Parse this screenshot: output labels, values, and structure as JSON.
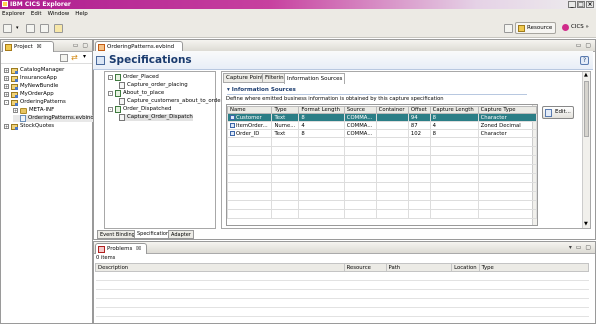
{
  "window": {
    "title": "IBM CICS Explorer"
  },
  "menu": [
    "Explorer",
    "Edit",
    "Window",
    "Help"
  ],
  "perspectives": {
    "resource": "Resource",
    "cics": "CICS",
    "more": "»"
  },
  "project_view": {
    "title": "Project",
    "tree": [
      {
        "label": "CatalogManager",
        "level": 0,
        "kind": "project",
        "expander": "+"
      },
      {
        "label": "InsuranceApp",
        "level": 0,
        "kind": "project",
        "expander": "+"
      },
      {
        "label": "MyNewBundle",
        "level": 0,
        "kind": "project",
        "expander": "+"
      },
      {
        "label": "MyOrderApp",
        "level": 0,
        "kind": "project",
        "expander": "+"
      },
      {
        "label": "OrderingPatterns",
        "level": 0,
        "kind": "project",
        "expander": "-"
      },
      {
        "label": "META-INF",
        "level": 1,
        "kind": "folder",
        "expander": "+"
      },
      {
        "label": "OrderingPatterns.evbind",
        "level": 1,
        "kind": "file",
        "expander": ""
      },
      {
        "label": "StockQuotes",
        "level": 0,
        "kind": "project",
        "expander": "+"
      }
    ]
  },
  "editor": {
    "tab": "OrderingPatterns.evbind",
    "header": "Specifications",
    "help": "?",
    "spec_tree": [
      {
        "label": "Order_Placed",
        "level": 0,
        "expander": "-"
      },
      {
        "label": "Capture_order_placing",
        "level": 1,
        "expander": ""
      },
      {
        "label": "About_to_place",
        "level": 0,
        "expander": "-"
      },
      {
        "label": "Capture_customers_about_to_order",
        "level": 1,
        "expander": ""
      },
      {
        "label": "Order_Dispatched",
        "level": 0,
        "expander": "-"
      },
      {
        "label": "Capture_Order_Dispatch",
        "level": 1,
        "expander": "",
        "selected": true
      }
    ],
    "inner_tabs": [
      "Capture Point",
      "Filtering",
      "Information Sources"
    ],
    "section": {
      "title": "Information Sources",
      "description": "Define where emitted business information is obtained by this capture specification"
    },
    "table": {
      "columns": [
        "Name",
        "Type",
        "Format Length",
        "Source",
        "Container",
        "Offset",
        "Capture Length",
        "Capture Type"
      ],
      "rows": [
        [
          "Customer",
          "Text",
          "8",
          "COMMA...",
          "",
          "94",
          "8",
          "Character"
        ],
        [
          "ItemOrder...",
          "Nume...",
          "4",
          "COMMA...",
          "",
          "87",
          "4",
          "Zoned Decimal"
        ],
        [
          "Order_ID",
          "Text",
          "8",
          "COMMA...",
          "",
          "102",
          "8",
          "Character"
        ]
      ]
    },
    "edit_button": "Edit...",
    "bottom_tabs": [
      "Event Binding",
      "Specification",
      "Adapter"
    ]
  },
  "problems": {
    "title": "Problems",
    "count": "0 items",
    "columns": [
      "Description",
      "Resource",
      "Path",
      "Location",
      "Type"
    ]
  },
  "colors": {
    "title_bar": "#ad1c8f",
    "selection": "#2b7e86",
    "header_text": "#1a3b6e"
  }
}
